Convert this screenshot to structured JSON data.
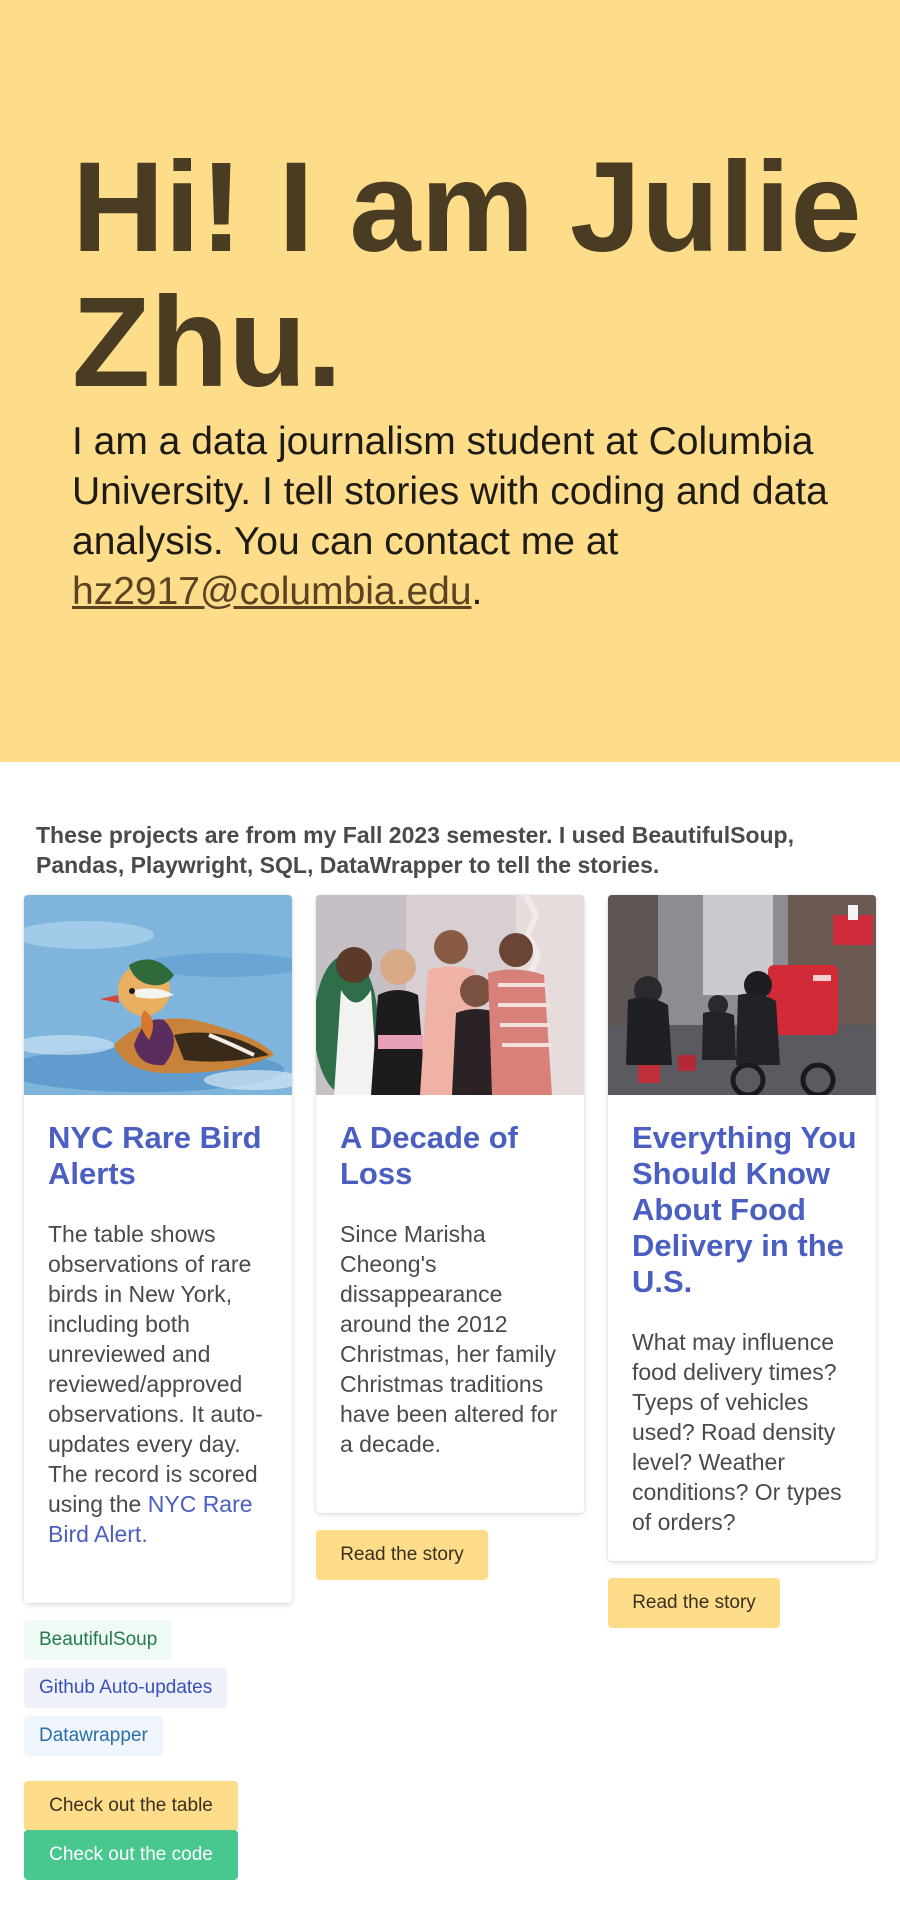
{
  "hero": {
    "title": "Hi! I am Julie Zhu.",
    "text_before": "I am a data journalism student at Columbia University. I tell stories with coding and data analysis. You can contact me at ",
    "email": "hz2917@columbia.edu",
    "text_after": "."
  },
  "intro": "These projects are from my Fall 2023 semester. I used BeautifulSoup, Pandas, Playwright, SQL, DataWrapper to tell the stories.",
  "projects": [
    {
      "title": "NYC Rare Bird Alerts",
      "body": "The table shows observations of rare birds in New York, including both unreviewed and reviewed/approved observations. It auto-updates every day. The record is scored using the ",
      "link": "NYC Rare Bird Alert.",
      "tags": [
        "BeautifulSoup",
        "Github Auto-updates",
        "Datawrapper"
      ],
      "button_primary": "Check out the table",
      "button_secondary": "Check out the code"
    },
    {
      "title": "A Decade of Loss",
      "body": "Since Marisha Cheong's dissappearance around the 2012 Christmas, her family Christmas traditions have been altered for a decade.",
      "button": "Read the story"
    },
    {
      "title": "Everything You Should Know About Food Delivery in the U.S.",
      "body": "What may influence food delivery times? Tyeps of vehicles used? Road density level? Weather conditions? Or types of orders?",
      "button": "Read the story"
    }
  ],
  "colors": {
    "hero_bg": "#fddc8a",
    "title": "#4a3c22",
    "card_title": "#4a5fc1",
    "button_yellow": "#fddc8a",
    "button_green": "#48c78e",
    "tag_beautifulsoup_bg": "#effaf5",
    "tag_github_bg": "#eff1fa",
    "tag_datawrapper_bg": "#eff5fb"
  }
}
